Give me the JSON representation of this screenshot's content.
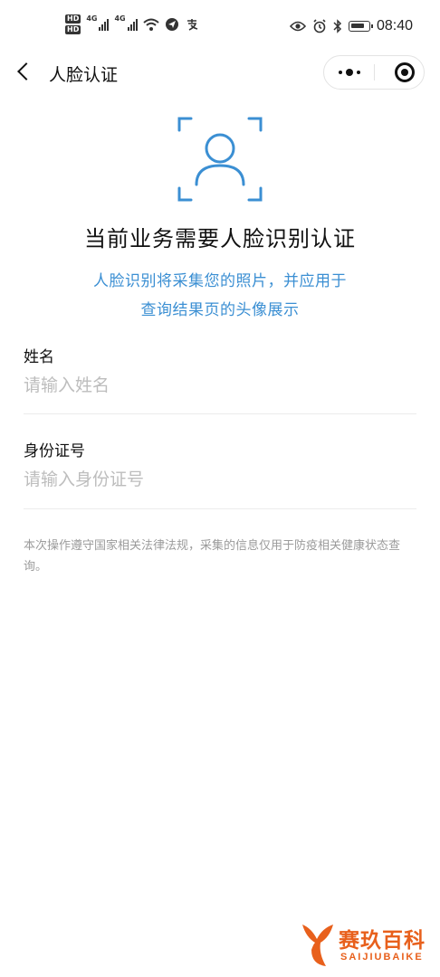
{
  "status_bar": {
    "hd_badges": [
      "HD",
      "HD"
    ],
    "network_types": [
      "4G",
      "4G"
    ],
    "time": "08:40",
    "icons": [
      "signal-icon",
      "signal-icon",
      "wifi-icon",
      "app-notification-icon",
      "alipay-icon",
      "eye-icon",
      "alarm-icon",
      "bluetooth-icon",
      "battery-icon"
    ]
  },
  "nav": {
    "title": "人脸认证"
  },
  "header": {
    "title": "当前业务需要人脸识别认证",
    "description_line1": "人脸识别将采集您的照片，并应用于",
    "description_line2": "查询结果页的头像展示",
    "accent_color": "#3b8fd3"
  },
  "form": {
    "name": {
      "label": "姓名",
      "placeholder": "请输入姓名",
      "value": ""
    },
    "id_number": {
      "label": "身份证号",
      "placeholder": "请输入身份证号",
      "value": ""
    }
  },
  "notice": {
    "text": "本次操作遵守国家相关法律法规，采集的信息仅用于防疫相关健康状态查询。"
  },
  "watermark": {
    "name_cn": "赛玖百科",
    "name_en": "SAIJIUBAIKE",
    "color": "#e8601c"
  }
}
